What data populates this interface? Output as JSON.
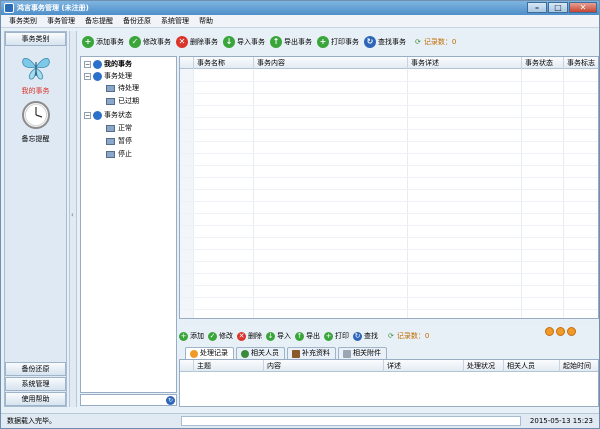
{
  "window": {
    "title": "鸿言事务管理 (未注册)",
    "min": "–",
    "max": "□",
    "close": "✕"
  },
  "menu": [
    "事务类别",
    "事务管理",
    "备忘提醒",
    "备份还原",
    "系统管理",
    "帮助"
  ],
  "left": {
    "header": "事务类别",
    "nav": [
      {
        "label": "我的事务",
        "icon": "butterfly-icon",
        "color": "#d9352a"
      },
      {
        "label": "备忘提醒",
        "icon": "clock-icon",
        "color": "#000"
      }
    ],
    "bottom": [
      "备份还原",
      "系统管理",
      "使用帮助"
    ]
  },
  "toolbar": {
    "add": "添加事务",
    "edit": "修改事务",
    "delete": "删除事务",
    "import": "导入事务",
    "export": "导出事务",
    "print": "打印事务",
    "find": "查找事务",
    "count_label": "记录数：0"
  },
  "tree": {
    "root": "我的事务",
    "nodes": [
      {
        "label": "事务处理",
        "children": [
          "待处理",
          "已过期"
        ]
      },
      {
        "label": "事务状态",
        "children": [
          "正常",
          "暂停",
          "停止"
        ]
      }
    ]
  },
  "grid": {
    "columns": [
      "事务名称",
      "事务内容",
      "事务详述",
      "事务状态",
      "事务标志"
    ]
  },
  "toolbar2": {
    "add": "添加",
    "edit": "修改",
    "delete": "删除",
    "import": "导入",
    "export": "导出",
    "print": "打印",
    "find": "查找",
    "count_label": "记录数：0"
  },
  "tabs": [
    "处理记录",
    "相关人员",
    "补充资料",
    "相关附件"
  ],
  "grid2": {
    "columns": [
      "主题",
      "内容",
      "详述",
      "处理状况",
      "相关人员",
      "起始时间"
    ]
  },
  "status": {
    "message": "数据载入完毕。",
    "datetime": "2015-05-13 15:23"
  },
  "colors": {
    "accent": "#4d8fc9",
    "selected_nav": "#d9352a",
    "count": "#c06a00"
  }
}
